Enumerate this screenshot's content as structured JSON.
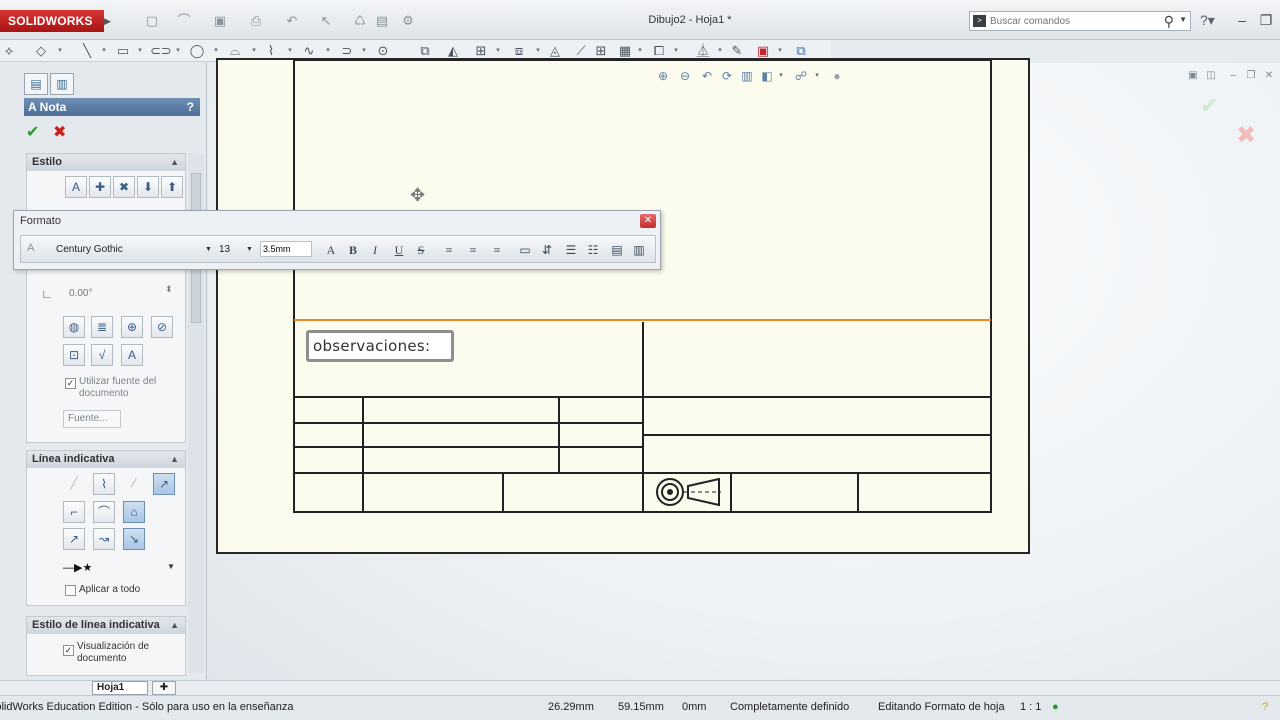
{
  "app": {
    "logo": "SOLIDWORKS",
    "document_title": "Dibujo2 - Hoja1 *",
    "search_placeholder": "Buscar comandos"
  },
  "property_manager": {
    "title": "Nota",
    "help": "?",
    "estilo": {
      "title": "Estilo"
    },
    "angle_value": "0.00°",
    "use_doc_font_label": "Utilizar fuente del documento",
    "font_button": "Fuente...",
    "linea_indicativa": {
      "title": "Línea indicativa",
      "apply_all_label": "Aplicar a todo"
    },
    "estilo_linea": {
      "title": "Estilo de línea indicativa",
      "doc_display_label": "Visualización de documento"
    }
  },
  "format_toolbar": {
    "title": "Formato",
    "font_name": "Century Gothic",
    "font_size": "13",
    "height_value": "3.5mm"
  },
  "drawing": {
    "note_text": "observaciones:"
  },
  "sheet_tabs": {
    "active": "Hoja1"
  },
  "status_bar": {
    "edition": "SolidWorks Education Edition - Sólo para uso en la enseñanza",
    "x": "26.29mm",
    "y": "59.15mm",
    "z": "0mm",
    "state": "Completamente definido",
    "mode": "Editando Formato de hoja",
    "scale": "1 : 1"
  },
  "colors": {
    "sheet": "#fbfbee",
    "accent_line": "#e8892b",
    "header": "#5a7aa2"
  }
}
